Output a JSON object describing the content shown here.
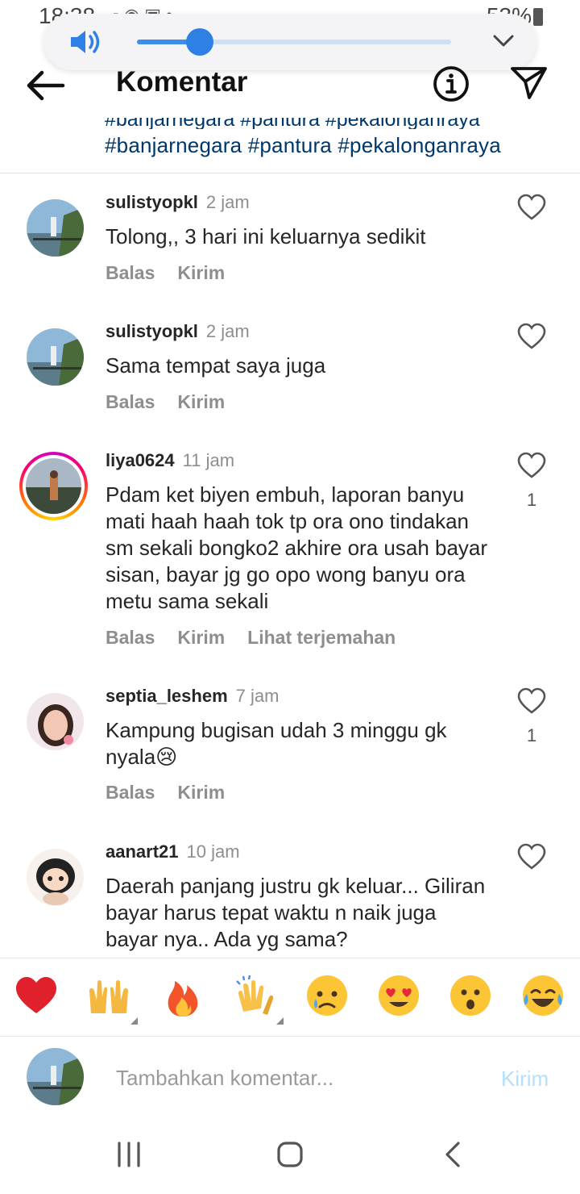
{
  "status_bar": {
    "time": "18:38",
    "battery": "53%"
  },
  "volume": {
    "level": 0.2
  },
  "header": {
    "title": "Komentar",
    "caption_partial": "#banjarnegara #pantura #pekalonganraya",
    "hashtags": "#banjarnegara #pantura #pekalonganraya"
  },
  "comments": [
    {
      "username": "sulistyopkl",
      "time": "2 jam",
      "text": "Tolong,, 3 hari ini keluarnya sedikit",
      "reply": "Balas",
      "send": "Kirim",
      "translate": "",
      "likes": ""
    },
    {
      "username": "sulistyopkl",
      "time": "2 jam",
      "text": "Sama tempat saya juga",
      "reply": "Balas",
      "send": "Kirim",
      "translate": "",
      "likes": ""
    },
    {
      "username": "liya0624",
      "time": "11 jam",
      "text": "Pdam ket biyen embuh, laporan banyu mati haah haah tok tp ora ono tindakan sm sekali bongko2 akhire ora usah bayar sisan, bayar jg go opo wong banyu ora metu sama sekali",
      "reply": "Balas",
      "send": "Kirim",
      "translate": "Lihat terjemahan",
      "likes": "1"
    },
    {
      "username": "septia_leshem",
      "time": "7 jam",
      "text": "Kampung bugisan udah 3 minggu gk nyala😢",
      "reply": "Balas",
      "send": "Kirim",
      "translate": "",
      "likes": "1"
    },
    {
      "username": "aanart21",
      "time": "10 jam",
      "text": "Daerah panjang justru gk keluar... Giliran bayar harus tepat waktu n naik juga bayar nya.. Ada yg sama?",
      "reply": "Balas",
      "send": "Kirim",
      "translate": "",
      "likes": ""
    }
  ],
  "emoji_bar": [
    {
      "icon": "red-heart-emoji"
    },
    {
      "icon": "raising-hands-emoji"
    },
    {
      "icon": "fire-emoji"
    },
    {
      "icon": "clapping-hands-emoji"
    },
    {
      "icon": "crying-face-emoji"
    },
    {
      "icon": "heart-eyes-emoji"
    },
    {
      "icon": "astonished-face-emoji"
    },
    {
      "icon": "tears-of-joy-emoji"
    }
  ],
  "input": {
    "placeholder": "Tambahkan komentar...",
    "post_label": "Kirim"
  },
  "colors": {
    "link": "#00376b",
    "muted": "#8e8e8e",
    "post_disabled": "#b2dffc",
    "volume_accent": "#2f80e4"
  }
}
